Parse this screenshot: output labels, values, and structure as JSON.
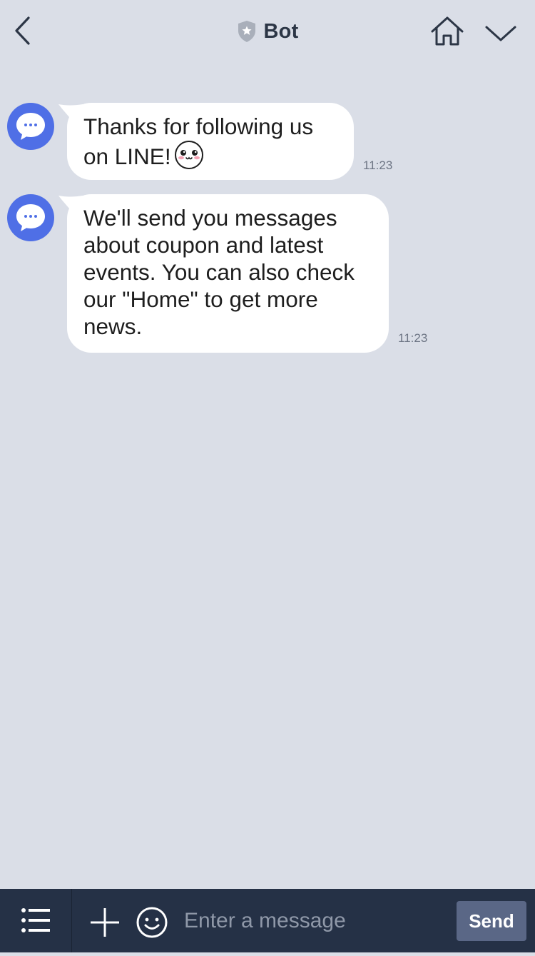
{
  "header": {
    "title": "Bot",
    "icons": {
      "back": "back-chevron-icon",
      "verified": "shield-star-icon",
      "home": "home-icon",
      "expand": "chevron-down-icon"
    }
  },
  "messages": [
    {
      "sender": "Bot",
      "text": "Thanks for following us on LINE!",
      "emoji": "blushing-face-icon",
      "time": "11:23"
    },
    {
      "sender": "Bot",
      "text": "We'll send you messages about coupon and latest events. You can also check our \"Home\" to get more news.",
      "time": "11:23"
    }
  ],
  "footer": {
    "input_placeholder": "Enter a message",
    "input_value": "",
    "send_label": "Send",
    "icons": {
      "menu": "list-menu-icon",
      "plus": "plus-icon",
      "emoji": "smiley-icon"
    }
  },
  "colors": {
    "background": "#dadee7",
    "bubble": "#ffffff",
    "avatar": "#4f6fe6",
    "footer": "#253146",
    "send_button": "#5a6786",
    "title_text": "#2c3646"
  }
}
